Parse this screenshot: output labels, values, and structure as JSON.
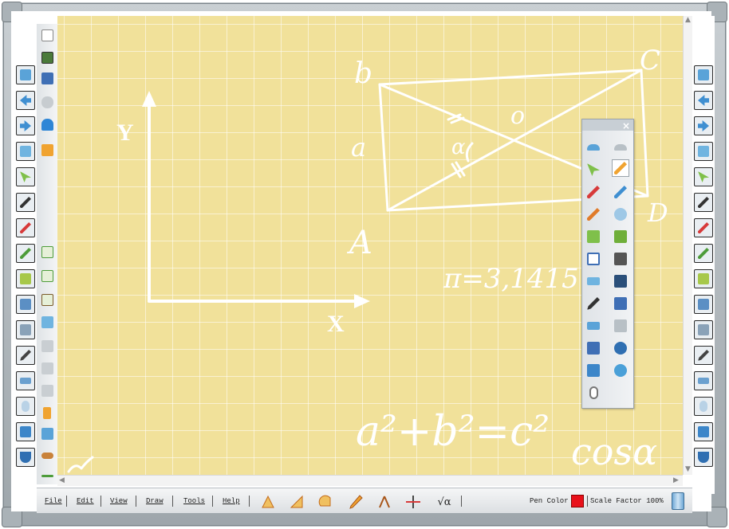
{
  "menubar": {
    "file": "File",
    "edit": "Edit",
    "view": "View",
    "draw": "Draw",
    "tools": "Tools",
    "help": "Help",
    "pen_color_label": "Pen Color",
    "pen_color": "#e8101a",
    "scale_label": "Scale Factor 100%"
  },
  "canvas": {
    "background": "#f1e19a",
    "axis_y_label": "Y",
    "axis_x_label": "X",
    "vertex_b": "b",
    "vertex_c": "C",
    "vertex_a_side": "a",
    "vertex_d": "D",
    "vertex_A": "A",
    "center_o": "o",
    "alpha": "α",
    "pi_eq": "π=3,1415",
    "pythagoras": "a²+b²=c²",
    "cos": "cosα"
  },
  "icons": {
    "sqrt_tool": "√α",
    "close": "×"
  }
}
